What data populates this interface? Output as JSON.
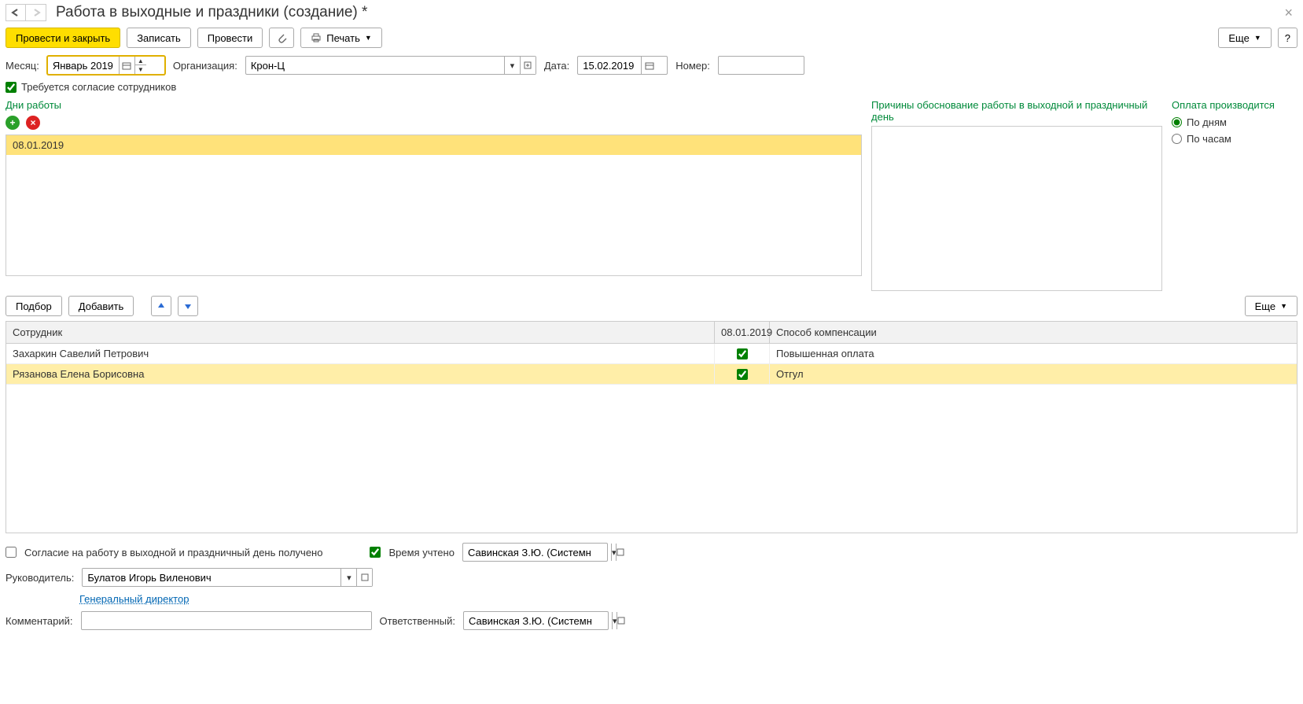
{
  "window": {
    "title": "Работа в выходные и праздники (создание) *"
  },
  "toolbar": {
    "post_close": "Провести и закрыть",
    "save": "Записать",
    "post": "Провести",
    "print": "Печать",
    "more": "Еще",
    "help": "?"
  },
  "form": {
    "month_label": "Месяц:",
    "month_value": "Январь 2019",
    "org_label": "Организация:",
    "org_value": "Крон-Ц",
    "date_label": "Дата:",
    "date_value": "15.02.2019",
    "number_label": "Номер:",
    "number_value": "",
    "consent_label": "Требуется согласие сотрудников",
    "consent_checked": true
  },
  "sections": {
    "days_label": "Дни работы",
    "reasons_label": "Причины обоснование работы в выходной и праздничный день",
    "pay_label": "Оплата производится",
    "pay_days": "По дням",
    "pay_hours": "По часам",
    "pay_selected": "days",
    "day_items": [
      "08.01.2019"
    ]
  },
  "mid": {
    "select": "Подбор",
    "add": "Добавить",
    "more": "Еще"
  },
  "grid": {
    "col_employee": "Сотрудник",
    "col_date": "08.01.2019",
    "col_comp": "Способ компенсации",
    "rows": [
      {
        "emp": "Захаркин Савелий Петрович",
        "checked": true,
        "comp": "Повышенная оплата",
        "sel": false
      },
      {
        "emp": "Рязанова Елена Борисовна",
        "checked": true,
        "comp": "Отгул",
        "sel": true
      }
    ]
  },
  "footer": {
    "consent_received": "Согласие на работу в выходной и праздничный день получено",
    "time_accounted": "Время учтено",
    "time_user": "Савинская З.Ю. (Системн",
    "manager_label": "Руководитель:",
    "manager_value": "Булатов Игорь Виленович",
    "manager_link": "Генеральный директор",
    "comment_label": "Комментарий:",
    "comment_value": "",
    "responsible_label": "Ответственный:",
    "responsible_value": "Савинская З.Ю. (Системн"
  }
}
